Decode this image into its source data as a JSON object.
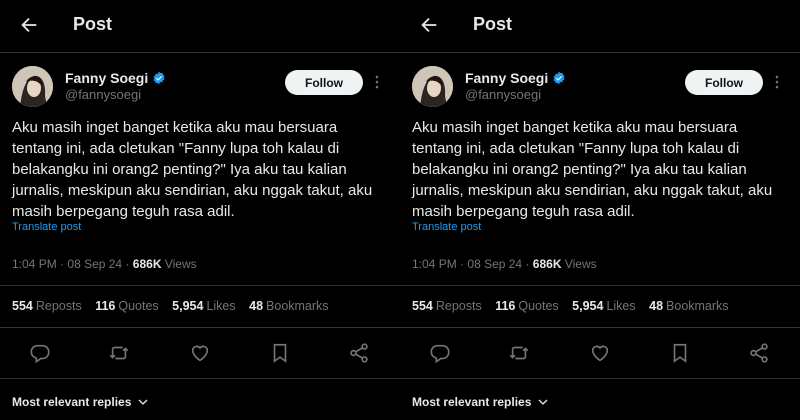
{
  "header": {
    "title": "Post",
    "back_icon": "arrow-left-icon"
  },
  "post": {
    "author_name": "Fanny Soegi",
    "author_handle": "@fannysoegi",
    "verified_icon": "verified-badge-icon",
    "follow_label": "Follow",
    "more_icon": "more-vertical-icon",
    "text_lines": [
      "Aku masih inget banget ketika aku mau bersuara",
      "tentang ini, ada cletukan \"Fanny lupa toh kalau di",
      "belakangku ini orang2 penting?\" Iya aku tau kalian",
      "jurnalis, meskipun aku sendirian, aku nggak takut, aku",
      "masih berpegang teguh rasa adil."
    ],
    "translate_label": "Translate post",
    "time": "1:04 PM",
    "separator": "·",
    "date": "08 Sep 24",
    "views_count": "686K",
    "views_label": "Views",
    "stats": {
      "reposts_count": "554",
      "reposts_label": "Reposts",
      "quotes_count": "116",
      "quotes_label": "Quotes",
      "likes_count": "5,954",
      "likes_label": "Likes",
      "bookmarks_count": "48",
      "bookmarks_label": "Bookmarks"
    }
  },
  "actions": [
    "reply-icon",
    "repost-icon",
    "like-icon",
    "bookmark-icon",
    "share-icon"
  ],
  "replies_sort": {
    "label": "Most relevant replies",
    "icon": "chevron-down-icon"
  },
  "colors": {
    "background": "#000000",
    "text": "#e7e9ea",
    "muted": "#71767b",
    "link": "#1d9bf0",
    "verified": "#1d9bf0",
    "divider": "#2f3336"
  }
}
